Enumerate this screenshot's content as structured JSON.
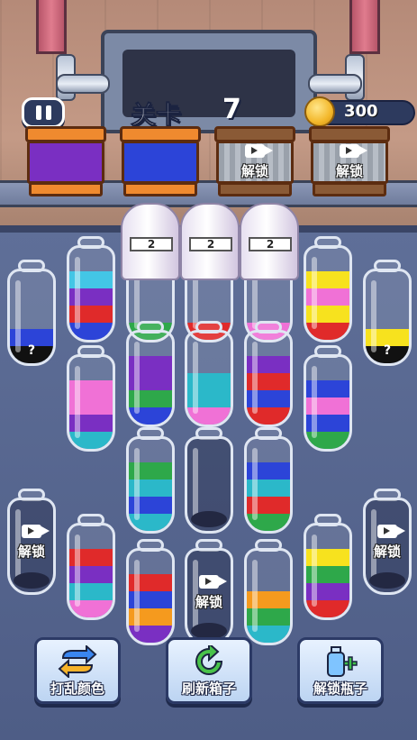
{
  "hud": {
    "level_label": "关卡",
    "level_number": "7",
    "coins": "300"
  },
  "colors": {
    "red": "#e02a2a",
    "blue": "#2c44d8",
    "purple": "#7a2fc2",
    "green": "#2ea84a",
    "cyan": "#2bb8c9",
    "pink": "#f071d6",
    "yellow": "#f7e21e",
    "orange": "#f59a1e",
    "black": "#111111",
    "lightblue": "#43c6e6"
  },
  "color_boxes": [
    {
      "state": "filled",
      "color": "purple"
    },
    {
      "state": "filled",
      "color": "blue"
    },
    {
      "state": "locked",
      "label": "解锁"
    },
    {
      "state": "locked",
      "label": "解锁"
    }
  ],
  "covered_bottles": [
    {
      "count": "2"
    },
    {
      "count": "2"
    },
    {
      "count": "2"
    }
  ],
  "bottles": [
    {
      "id": "b1",
      "layers": [
        "black",
        "blue"
      ],
      "hidden": "?"
    },
    {
      "id": "b2",
      "layers": [
        "blue",
        "red",
        "purple",
        "lightblue"
      ]
    },
    {
      "id": "b3",
      "layers": [
        "green"
      ]
    },
    {
      "id": "b4",
      "layers": [
        "red"
      ]
    },
    {
      "id": "b5",
      "layers": [
        "pink"
      ]
    },
    {
      "id": "b6",
      "layers": [
        "red",
        "yellow",
        "pink",
        "yellow"
      ]
    },
    {
      "id": "b7",
      "layers": [
        "black",
        "yellow"
      ],
      "hidden": "?"
    },
    {
      "id": "b8",
      "layers": [
        "cyan",
        "purple",
        "pink",
        "pink"
      ]
    },
    {
      "id": "b9",
      "layers": [
        "blue",
        "green",
        "purple",
        "purple"
      ]
    },
    {
      "id": "b10",
      "layers": [
        "pink",
        "cyan",
        "cyan"
      ]
    },
    {
      "id": "b11",
      "layers": [
        "red",
        "blue",
        "red",
        "purple"
      ]
    },
    {
      "id": "b12",
      "layers": [
        "green",
        "blue",
        "pink",
        "blue"
      ]
    },
    {
      "id": "b13",
      "layers": [
        "cyan",
        "blue",
        "cyan",
        "green"
      ]
    },
    {
      "id": "b14",
      "layers": []
    },
    {
      "id": "b15",
      "layers": [
        "green",
        "red",
        "cyan",
        "blue"
      ]
    },
    {
      "id": "b16",
      "locked": true,
      "label": "解锁"
    },
    {
      "id": "b17",
      "layers": [
        "pink",
        "cyan",
        "purple",
        "red"
      ]
    },
    {
      "id": "b18",
      "layers": [
        "purple",
        "orange",
        "blue",
        "red"
      ]
    },
    {
      "id": "b19",
      "locked": true,
      "label": "解锁"
    },
    {
      "id": "b20",
      "layers": [
        "cyan",
        "green",
        "orange"
      ]
    },
    {
      "id": "b21",
      "layers": [
        "red",
        "purple",
        "green",
        "yellow"
      ]
    },
    {
      "id": "b22",
      "locked": true,
      "label": "解锁"
    }
  ],
  "tools": {
    "shuffle": "打乱颜色",
    "refresh": "刷新箱子",
    "unlock": "解锁瓶子"
  }
}
